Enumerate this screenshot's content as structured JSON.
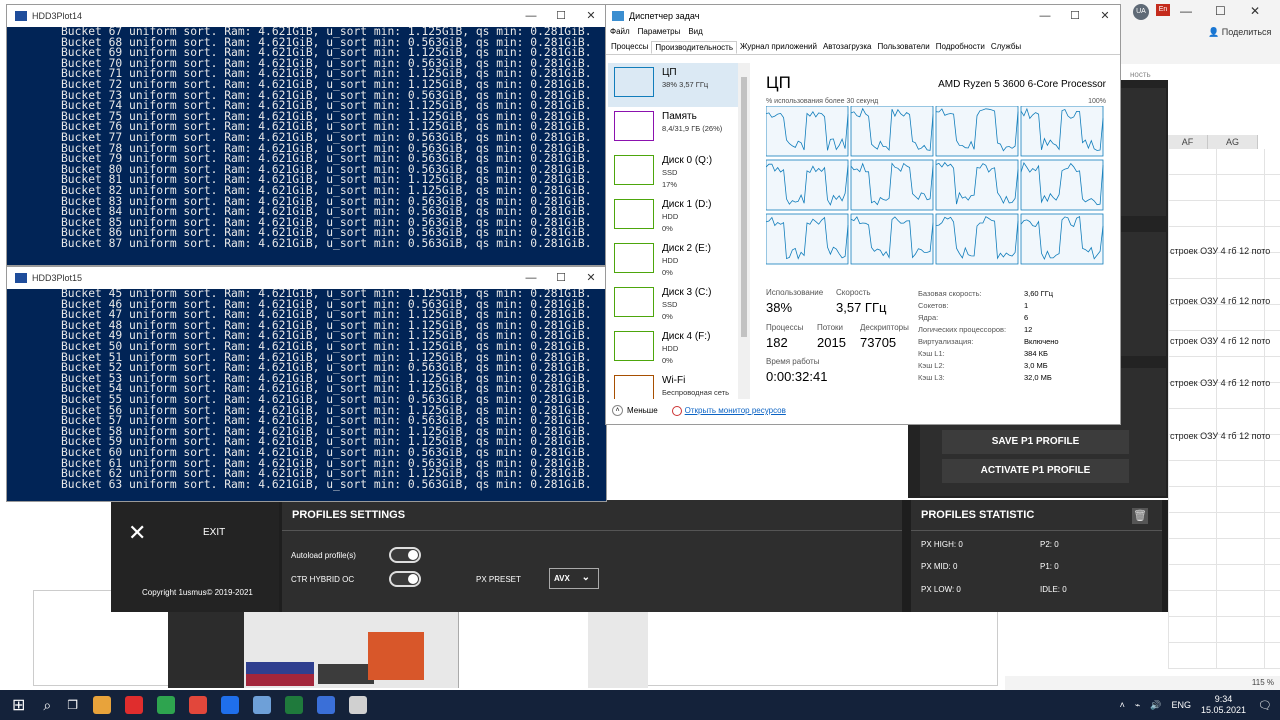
{
  "console_top": {
    "title": "HDD3Plot14",
    "lines": [
      "Bucket 67 uniform sort. Ram: 4.621GiB, u_sort min: 1.125GiB, qs min: 0.281GiB.",
      "Bucket 68 uniform sort. Ram: 4.621GiB, u_sort min: 0.563GiB, qs min: 0.281GiB.",
      "Bucket 69 uniform sort. Ram: 4.621GiB, u_sort min: 1.125GiB, qs min: 0.281GiB.",
      "Bucket 70 uniform sort. Ram: 4.621GiB, u_sort min: 0.563GiB, qs min: 0.281GiB.",
      "Bucket 71 uniform sort. Ram: 4.621GiB, u_sort min: 1.125GiB, qs min: 0.281GiB.",
      "Bucket 72 uniform sort. Ram: 4.621GiB, u_sort min: 1.125GiB, qs min: 0.281GiB.",
      "Bucket 73 uniform sort. Ram: 4.621GiB, u_sort min: 0.563GiB, qs min: 0.281GiB.",
      "Bucket 74 uniform sort. Ram: 4.621GiB, u_sort min: 1.125GiB, qs min: 0.281GiB.",
      "Bucket 75 uniform sort. Ram: 4.621GiB, u_sort min: 1.125GiB, qs min: 0.281GiB.",
      "Bucket 76 uniform sort. Ram: 4.621GiB, u_sort min: 1.125GiB, qs min: 0.281GiB.",
      "Bucket 77 uniform sort. Ram: 4.621GiB, u_sort min: 0.563GiB, qs min: 0.281GiB.",
      "Bucket 78 uniform sort. Ram: 4.621GiB, u_sort min: 0.563GiB, qs min: 0.281GiB.",
      "Bucket 79 uniform sort. Ram: 4.621GiB, u_sort min: 0.563GiB, qs min: 0.281GiB.",
      "Bucket 80 uniform sort. Ram: 4.621GiB, u_sort min: 0.563GiB, qs min: 0.281GiB.",
      "Bucket 81 uniform sort. Ram: 4.621GiB, u_sort min: 1.125GiB, qs min: 0.281GiB.",
      "Bucket 82 uniform sort. Ram: 4.621GiB, u_sort min: 1.125GiB, qs min: 0.281GiB.",
      "Bucket 83 uniform sort. Ram: 4.621GiB, u_sort min: 0.563GiB, qs min: 0.281GiB.",
      "Bucket 84 uniform sort. Ram: 4.621GiB, u_sort min: 0.563GiB, qs min: 0.281GiB.",
      "Bucket 85 uniform sort. Ram: 4.621GiB, u_sort min: 0.563GiB, qs min: 0.281GiB.",
      "Bucket 86 uniform sort. Ram: 4.621GiB, u_sort min: 0.563GiB, qs min: 0.281GiB.",
      "Bucket 87 uniform sort. Ram: 4.621GiB, u_sort min: 0.563GiB, qs min: 0.281GiB."
    ]
  },
  "console_bottom": {
    "title": "HDD3Plot15",
    "lines": [
      "Bucket 45 uniform sort. Ram: 4.621GiB, u_sort min: 1.125GiB, qs min: 0.281GiB.",
      "Bucket 46 uniform sort. Ram: 4.621GiB, u_sort min: 0.563GiB, qs min: 0.281GiB.",
      "Bucket 47 uniform sort. Ram: 4.621GiB, u_sort min: 1.125GiB, qs min: 0.281GiB.",
      "Bucket 48 uniform sort. Ram: 4.621GiB, u_sort min: 1.125GiB, qs min: 0.281GiB.",
      "Bucket 49 uniform sort. Ram: 4.621GiB, u_sort min: 1.125GiB, qs min: 0.281GiB.",
      "Bucket 50 uniform sort. Ram: 4.621GiB, u_sort min: 1.125GiB, qs min: 0.281GiB.",
      "Bucket 51 uniform sort. Ram: 4.621GiB, u_sort min: 1.125GiB, qs min: 0.281GiB.",
      "Bucket 52 uniform sort. Ram: 4.621GiB, u_sort min: 0.563GiB, qs min: 0.281GiB.",
      "Bucket 53 uniform sort. Ram: 4.621GiB, u_sort min: 1.125GiB, qs min: 0.281GiB.",
      "Bucket 54 uniform sort. Ram: 4.621GiB, u_sort min: 1.125GiB, qs min: 0.281GiB.",
      "Bucket 55 uniform sort. Ram: 4.621GiB, u_sort min: 0.563GiB, qs min: 0.281GiB.",
      "Bucket 56 uniform sort. Ram: 4.621GiB, u_sort min: 1.125GiB, qs min: 0.281GiB.",
      "Bucket 57 uniform sort. Ram: 4.621GiB, u_sort min: 0.563GiB, qs min: 0.281GiB.",
      "Bucket 58 uniform sort. Ram: 4.621GiB, u_sort min: 1.125GiB, qs min: 0.281GiB.",
      "Bucket 59 uniform sort. Ram: 4.621GiB, u_sort min: 1.125GiB, qs min: 0.281GiB.",
      "Bucket 60 uniform sort. Ram: 4.621GiB, u_sort min: 0.563GiB, qs min: 0.281GiB.",
      "Bucket 61 uniform sort. Ram: 4.621GiB, u_sort min: 0.563GiB, qs min: 0.281GiB.",
      "Bucket 62 uniform sort. Ram: 4.621GiB, u_sort min: 1.125GiB, qs min: 0.281GiB.",
      "Bucket 63 uniform sort. Ram: 4.621GiB, u_sort min: 0.563GiB, qs min: 0.281GiB."
    ]
  },
  "task_manager": {
    "title": "Диспетчер задач",
    "menu": [
      "Файл",
      "Параметры",
      "Вид"
    ],
    "tabs": [
      "Процессы",
      "Производительность",
      "Журнал приложений",
      "Автозагрузка",
      "Пользователи",
      "Подробности",
      "Службы"
    ],
    "active_tab": "Производительность",
    "sidebar": [
      {
        "name": "ЦП",
        "sub1": "38% 3,57 ГГц",
        "sub2": "",
        "color": "#117dbb"
      },
      {
        "name": "Память",
        "sub1": "8,4/31,9 ГБ (26%)",
        "sub2": "",
        "color": "#8b12ae"
      },
      {
        "name": "Диск 0 (Q:)",
        "sub1": "SSD",
        "sub2": "17%",
        "color": "#4da60c"
      },
      {
        "name": "Диск 1 (D:)",
        "sub1": "HDD",
        "sub2": "0%",
        "color": "#4da60c"
      },
      {
        "name": "Диск 2 (E:)",
        "sub1": "HDD",
        "sub2": "0%",
        "color": "#4da60c"
      },
      {
        "name": "Диск 3 (C:)",
        "sub1": "SSD",
        "sub2": "0%",
        "color": "#4da60c"
      },
      {
        "name": "Диск 4 (F:)",
        "sub1": "HDD",
        "sub2": "0%",
        "color": "#4da60c"
      },
      {
        "name": "Wi-Fi",
        "sub1": "Беспроводная сеть",
        "sub2": "",
        "color": "#a74f01"
      }
    ],
    "cpu": {
      "heading": "ЦП",
      "model": "AMD Ryzen 5 3600 6-Core Processor",
      "graph_label": "% использования более 30 секунд",
      "graph_max": "100%",
      "usage_label": "Использование",
      "usage_value": "38%",
      "speed_label": "Скорость",
      "speed_value": "3,57 ГГц",
      "proc_label": "Процессы",
      "proc_value": "182",
      "threads_label": "Потоки",
      "threads_value": "2015",
      "handles_label": "Дескрипторы",
      "handles_value": "73705",
      "uptime_label": "Время работы",
      "uptime_value": "0:00:32:41",
      "specs": [
        {
          "k": "Базовая скорость:",
          "v": "3,60 ГГц"
        },
        {
          "k": "Сокетов:",
          "v": "1"
        },
        {
          "k": "Ядра:",
          "v": "6"
        },
        {
          "k": "Логических процессоров:",
          "v": "12"
        },
        {
          "k": "Виртуализация:",
          "v": "Включено"
        },
        {
          "k": "Кэш L1:",
          "v": "384 КБ"
        },
        {
          "k": "Кэш L2:",
          "v": "3,0 МБ"
        },
        {
          "k": "Кэш L3:",
          "v": "32,0 МБ"
        }
      ]
    },
    "fewer": "Меньше",
    "resmon": "Открыть монитор ресурсов"
  },
  "oc_app": {
    "save_profile": "SAVE P1 PROFILE",
    "activate_profile": "ACTIVATE P1 PROFILE",
    "exit": "EXIT",
    "copyright": "Copyright 1usmus© 2019-2021",
    "profiles_settings": "PROFILES SETTINGS",
    "autoload": "Autoload profile(s)",
    "ctr_hybrid": "CTR HYBRID OC",
    "px_preset": "PX PRESET",
    "px_preset_value": "AVX",
    "profiles_statistic": "PROFILES STATISTIC",
    "stats": {
      "px_high": "PX HIGH: 0",
      "px_mid": "PX MID: 0",
      "px_low": "PX LOW: 0",
      "p2": "P2: 0",
      "p1": "P1: 0",
      "idle": "IDLE: 0"
    }
  },
  "excel": {
    "avatar": "UA",
    "share": "Поделиться",
    "hint": "ность",
    "col_af": "AF",
    "col_ag": "AG",
    "cell_text": "строек ОЗУ 4 гб 12 пото",
    "zoom": "115 %"
  },
  "taskbar": {
    "lang": "ENG",
    "time": "9:34",
    "date": "15.05.2021",
    "icon_colors": [
      "#e8a33b",
      "#e02d2d",
      "#2ea44f",
      "#e2473b",
      "#1f6feb",
      "#6ea0d8",
      "#1f7a3c",
      "#3a6fd8",
      "#d0d0d0"
    ]
  }
}
